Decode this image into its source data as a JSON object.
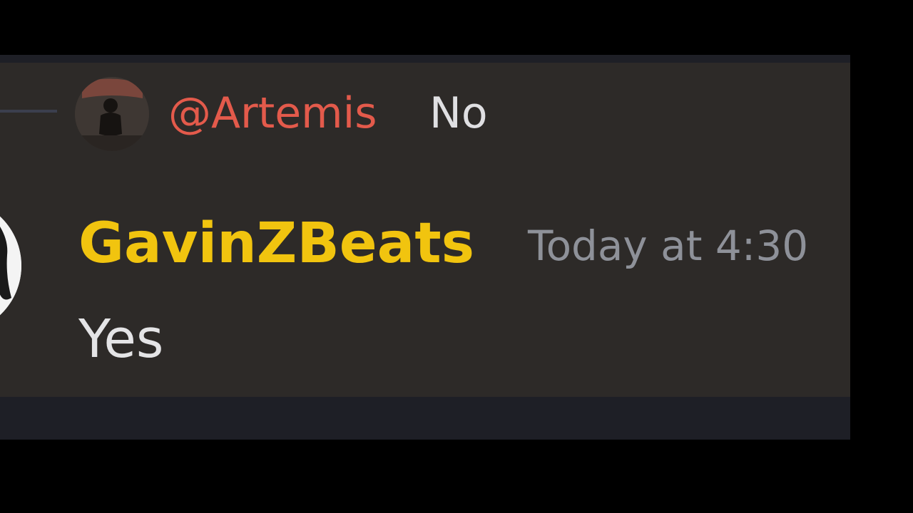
{
  "reply": {
    "mention": "@Artemis",
    "text": "No",
    "avatar_icon": "user-avatar-icon"
  },
  "message": {
    "username": "GavinZBeats",
    "timestamp": "Today at 4:30",
    "content": "Yes",
    "avatar_icon": "user-avatar-icon"
  },
  "colors": {
    "background": "#000000",
    "message_bg": "#2d2a28",
    "mention": "#e35a4b",
    "username": "#f1c40f",
    "timestamp": "#8e9199",
    "text": "#e4e4e6"
  }
}
